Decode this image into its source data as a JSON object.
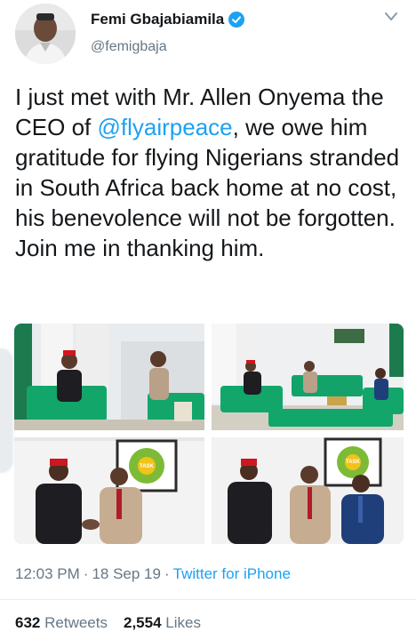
{
  "user": {
    "display_name": "Femi Gbajabiamila",
    "handle": "@femigbaja",
    "verified": true
  },
  "tweet": {
    "text_before": "I just met with Mr. Allen Onyema the CEO of ",
    "mention": "@flyairpeace",
    "text_after": ", we owe him gratitude for flying Nigerians stranded in South Africa back home at no cost, his benevolence will not be forgotten. Join me in thanking him."
  },
  "photos": [
    {
      "logo_text": ""
    },
    {
      "logo_text": ""
    },
    {
      "logo_text": "TASK"
    },
    {
      "logo_text": "TASK"
    }
  ],
  "meta": {
    "time": "12:03 PM",
    "separator": "·",
    "date": "18 Sep 19",
    "source": "Twitter for iPhone"
  },
  "stats": {
    "retweets_count": "632",
    "retweets_label": "Retweets",
    "likes_count": "2,554",
    "likes_label": "Likes"
  },
  "colors": {
    "link": "#1da1f2",
    "secondary_text": "#657786",
    "primary_text": "#14171a"
  }
}
